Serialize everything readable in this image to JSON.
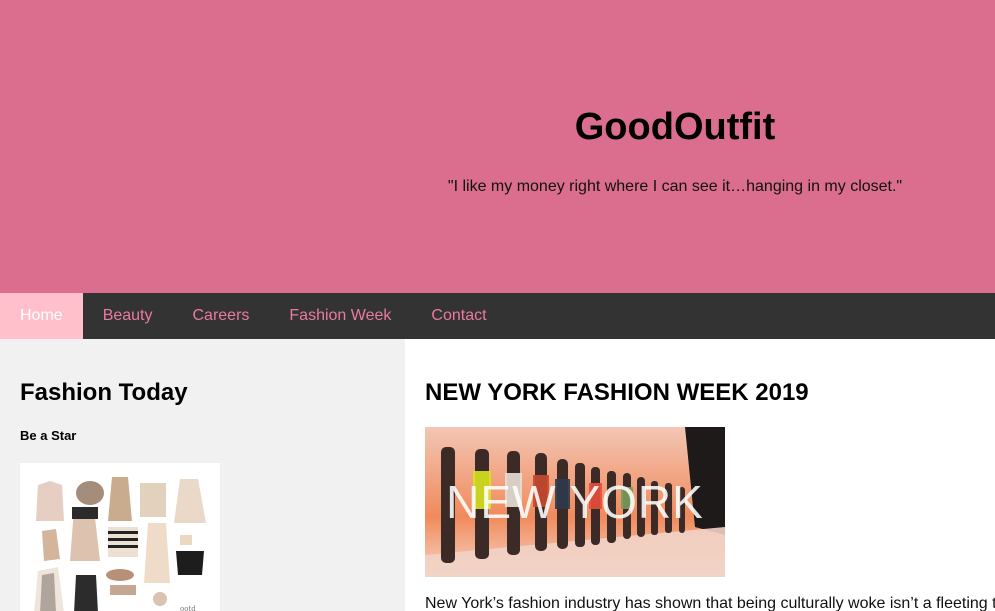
{
  "header": {
    "title": "GoodOutfit",
    "tagline": "\"I like my money right where I can see it…hanging in my closet.\"",
    "background": "#db6e8f"
  },
  "nav": {
    "items": [
      {
        "label": "Home",
        "active": true
      },
      {
        "label": "Beauty"
      },
      {
        "label": "Careers"
      },
      {
        "label": "Fashion Week"
      },
      {
        "label": "Contact"
      }
    ],
    "background": "#333333",
    "link_color": "#e97aa0",
    "active_background": "#ffc0cb"
  },
  "sidebar": {
    "heading": "Fashion Today",
    "subheading": "Be a Star",
    "image_icon": "outfit-collage-image"
  },
  "main": {
    "heading": "NEW YORK FASHION WEEK 2019",
    "image_overlay_text": "NEW YORK",
    "image_icon": "runway-photo",
    "article_text": "New York’s fashion industry has shown that being culturally woke isn’t a fleeting t"
  }
}
